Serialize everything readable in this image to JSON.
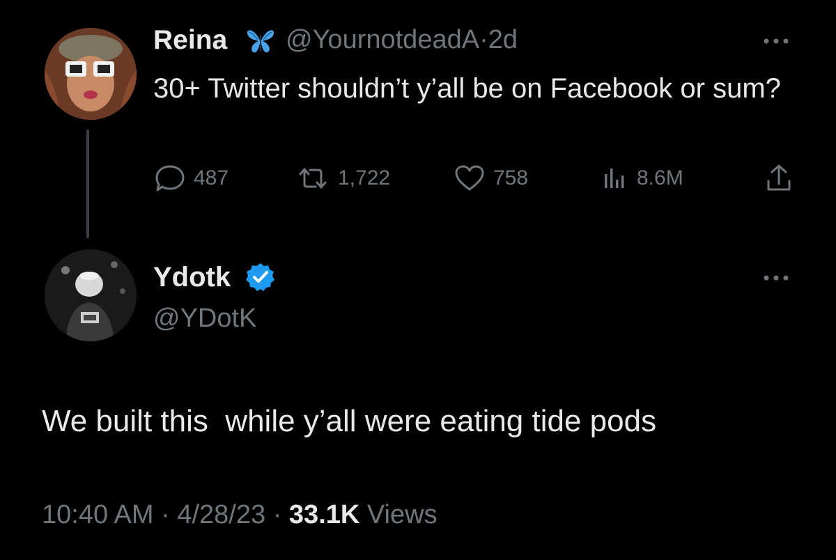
{
  "parent_tweet": {
    "author_name": "Reina",
    "handle": "@YournotdeadA",
    "separator": "·",
    "age": "2d",
    "text": "30+ Twitter shouldn’t y’all be on Facebook or sum?",
    "badge_icon": "butterfly-icon",
    "actions": {
      "replies": "487",
      "retweets": "1,722",
      "likes": "758",
      "views": "8.6M"
    }
  },
  "reply_tweet": {
    "author_name": "Ydotk",
    "handle": "@YDotK",
    "badge_icon": "verified-badge-icon",
    "text": "We built this  while y’all were eating tide pods",
    "time": "10:40 AM",
    "separator": "·",
    "date": "4/28/23",
    "views_count": "33.1K",
    "views_label": "Views"
  },
  "colors": {
    "background": "#000000",
    "primary_text": "#e7e9ea",
    "secondary_text": "#71767b",
    "verified_blue": "#1d9bf0",
    "butterfly_blue": "#4aa3e8"
  }
}
